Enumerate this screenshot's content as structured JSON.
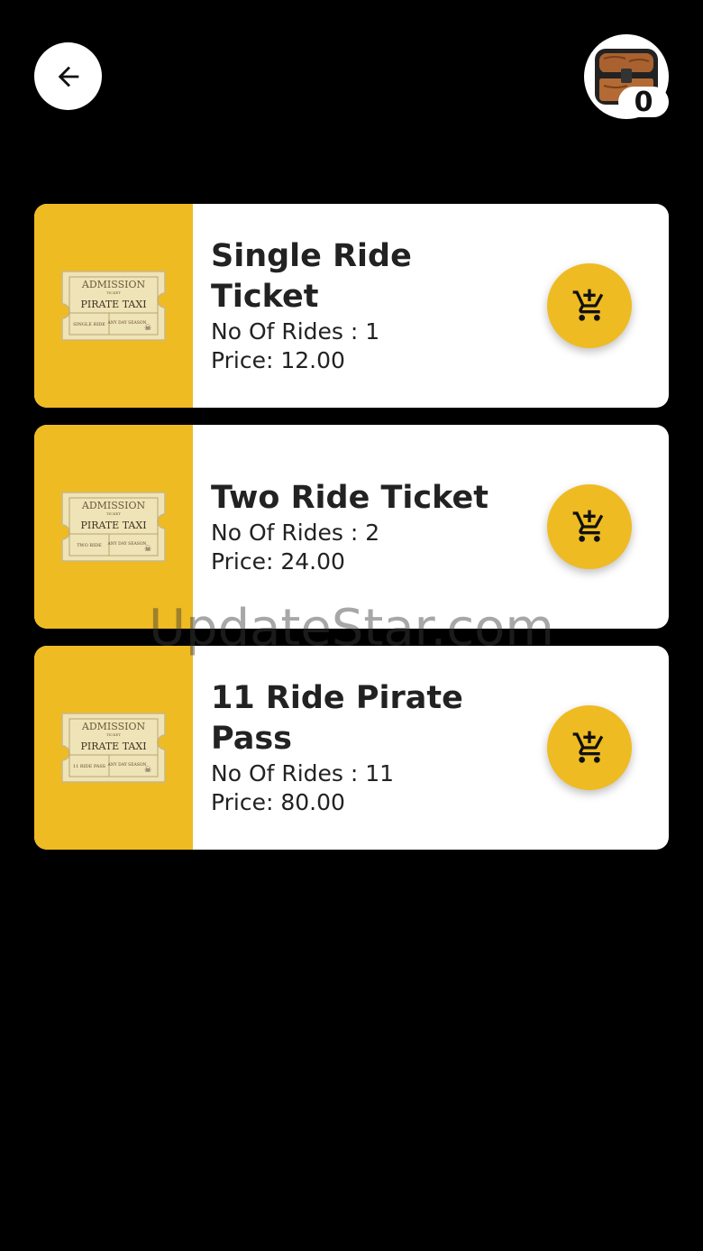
{
  "header": {
    "back_icon": "arrow-left-icon",
    "cart_icon": "treasure-chest-icon",
    "cart_count": "0"
  },
  "tickets": [
    {
      "title": "Single Ride Ticket",
      "rides": "No Of Rides : 1",
      "price": "Price: 12.00",
      "ticket_text": [
        "ADMISSION",
        "TICKET",
        "PIRATE TAXI",
        "SINGLE RIDE",
        "ANY DAY SEASON"
      ]
    },
    {
      "title": "Two Ride Ticket",
      "rides": "No Of Rides : 2",
      "price": "Price: 24.00",
      "ticket_text": [
        "ADMISSION",
        "TICKET",
        "PIRATE TAXI",
        "TWO RIDE",
        "ANY DAY SEASON"
      ]
    },
    {
      "title": "11 Ride Pirate Pass",
      "rides": "No Of Rides : 11",
      "price": "Price: 80.00",
      "ticket_text": [
        "ADMISSION",
        "TICKET",
        "PIRATE TAXI",
        "11 RIDE PASS",
        "ANY DAY SEASON"
      ]
    }
  ],
  "add_icon": "add-shopping-cart-icon",
  "watermark": "UpdateStar.com",
  "colors": {
    "background": "#000000",
    "accent": "#efbb22",
    "card": "#ffffff",
    "text": "#222222"
  }
}
